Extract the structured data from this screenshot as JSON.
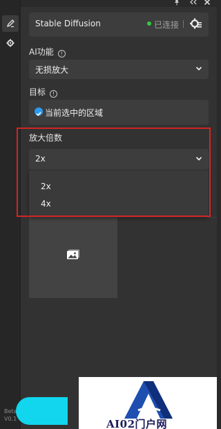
{
  "connection": {
    "title": "Stable Diffusion",
    "status": "已连接"
  },
  "ai_function": {
    "label": "AI功能",
    "info_glyph": "!",
    "selected": "无损放大"
  },
  "target": {
    "label": "目标",
    "info_glyph": "!",
    "option": "当前选中的区域"
  },
  "scale": {
    "label": "放大倍数",
    "selected": "2x",
    "options": [
      "2x",
      "4x"
    ]
  },
  "version": {
    "line1": "Beta",
    "line2": "V0.1"
  },
  "watermark": {
    "text": "AI02门户网"
  },
  "colors": {
    "accent": "#11d6ee",
    "status_green": "#2ecc40",
    "highlight_red": "#d32424",
    "check_blue": "#2b9af3"
  },
  "icons": {
    "rail": [
      "brush-icon",
      "gear-icon"
    ],
    "window": [
      "pin-icon",
      "collapse-icon",
      "close-icon"
    ]
  }
}
